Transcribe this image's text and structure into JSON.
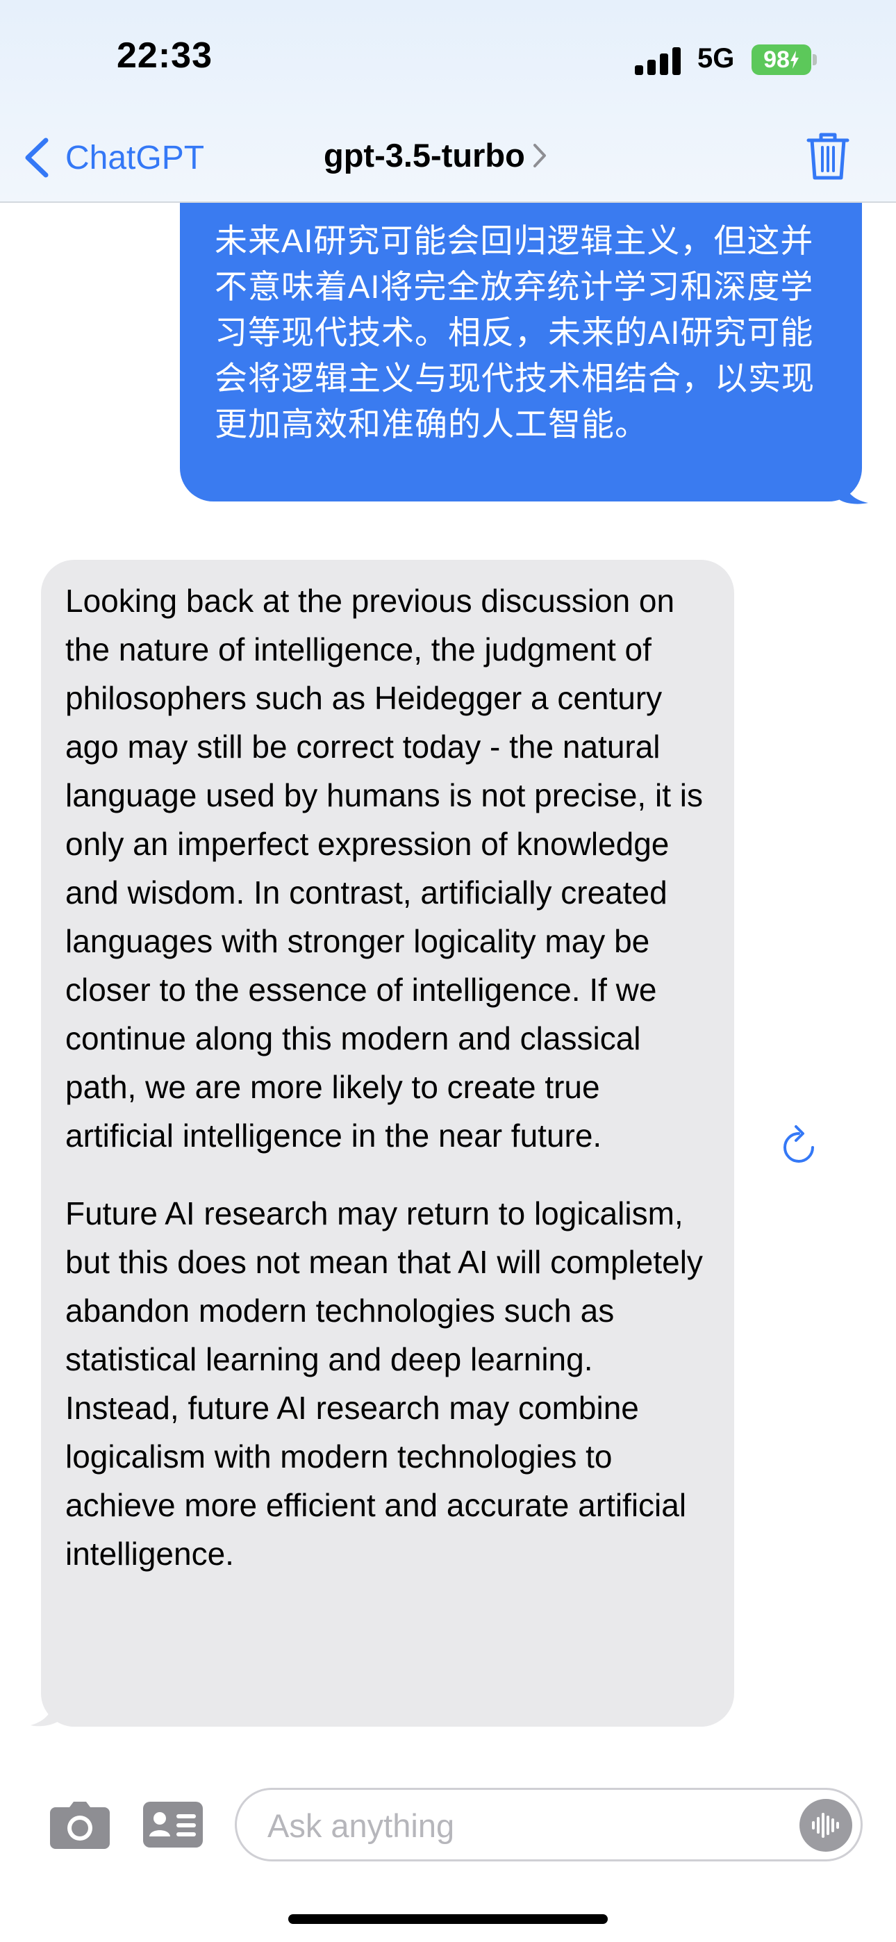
{
  "status_bar": {
    "time": "22:33",
    "network": "5G",
    "battery": "98"
  },
  "nav": {
    "back_label": "ChatGPT",
    "title": "gpt-3.5-turbo",
    "trash_icon": "trash-icon"
  },
  "messages": {
    "user": {
      "text": "未来AI研究可能会回归逻辑主义，但这并不意味着AI将完全放弃统计学习和深度学习等现代技术。相反，未来的AI研究可能会将逻辑主义与现代技术相结合，以实现更加高效和准确的人工智能。"
    },
    "assistant": {
      "paragraphs": [
        "Looking back at the previous discussion on the nature of intelligence, the judgment of philosophers such as Heidegger a century ago may still be correct today - the natural language used by humans is not precise, it is only an imperfect expression of knowledge and wisdom. In contrast, artificially created languages with stronger logicality may be closer to the essence of intelligence. If we continue along this modern and classical path, we are more likely to create true artificial intelligence in the near future.",
        "Future AI research may return to logicalism, but this does not mean that AI will completely abandon modern technologies such as statistical learning and deep learning. Instead, future AI research may combine logicalism with modern technologies to achieve more efficient and accurate artificial intelligence."
      ]
    }
  },
  "composer": {
    "placeholder": "Ask anything",
    "value": ""
  },
  "icons": {
    "back": "chevron-left-icon",
    "title_chevron": "chevron-right-icon",
    "regenerate": "refresh-icon",
    "camera": "camera-icon",
    "contact": "contact-card-icon",
    "voice": "waveform-icon"
  },
  "colors": {
    "accent": "#3478f6",
    "user_bubble": "#3a7bf0",
    "assistant_bubble": "#e9e9eb",
    "battery": "#5cc85a"
  }
}
